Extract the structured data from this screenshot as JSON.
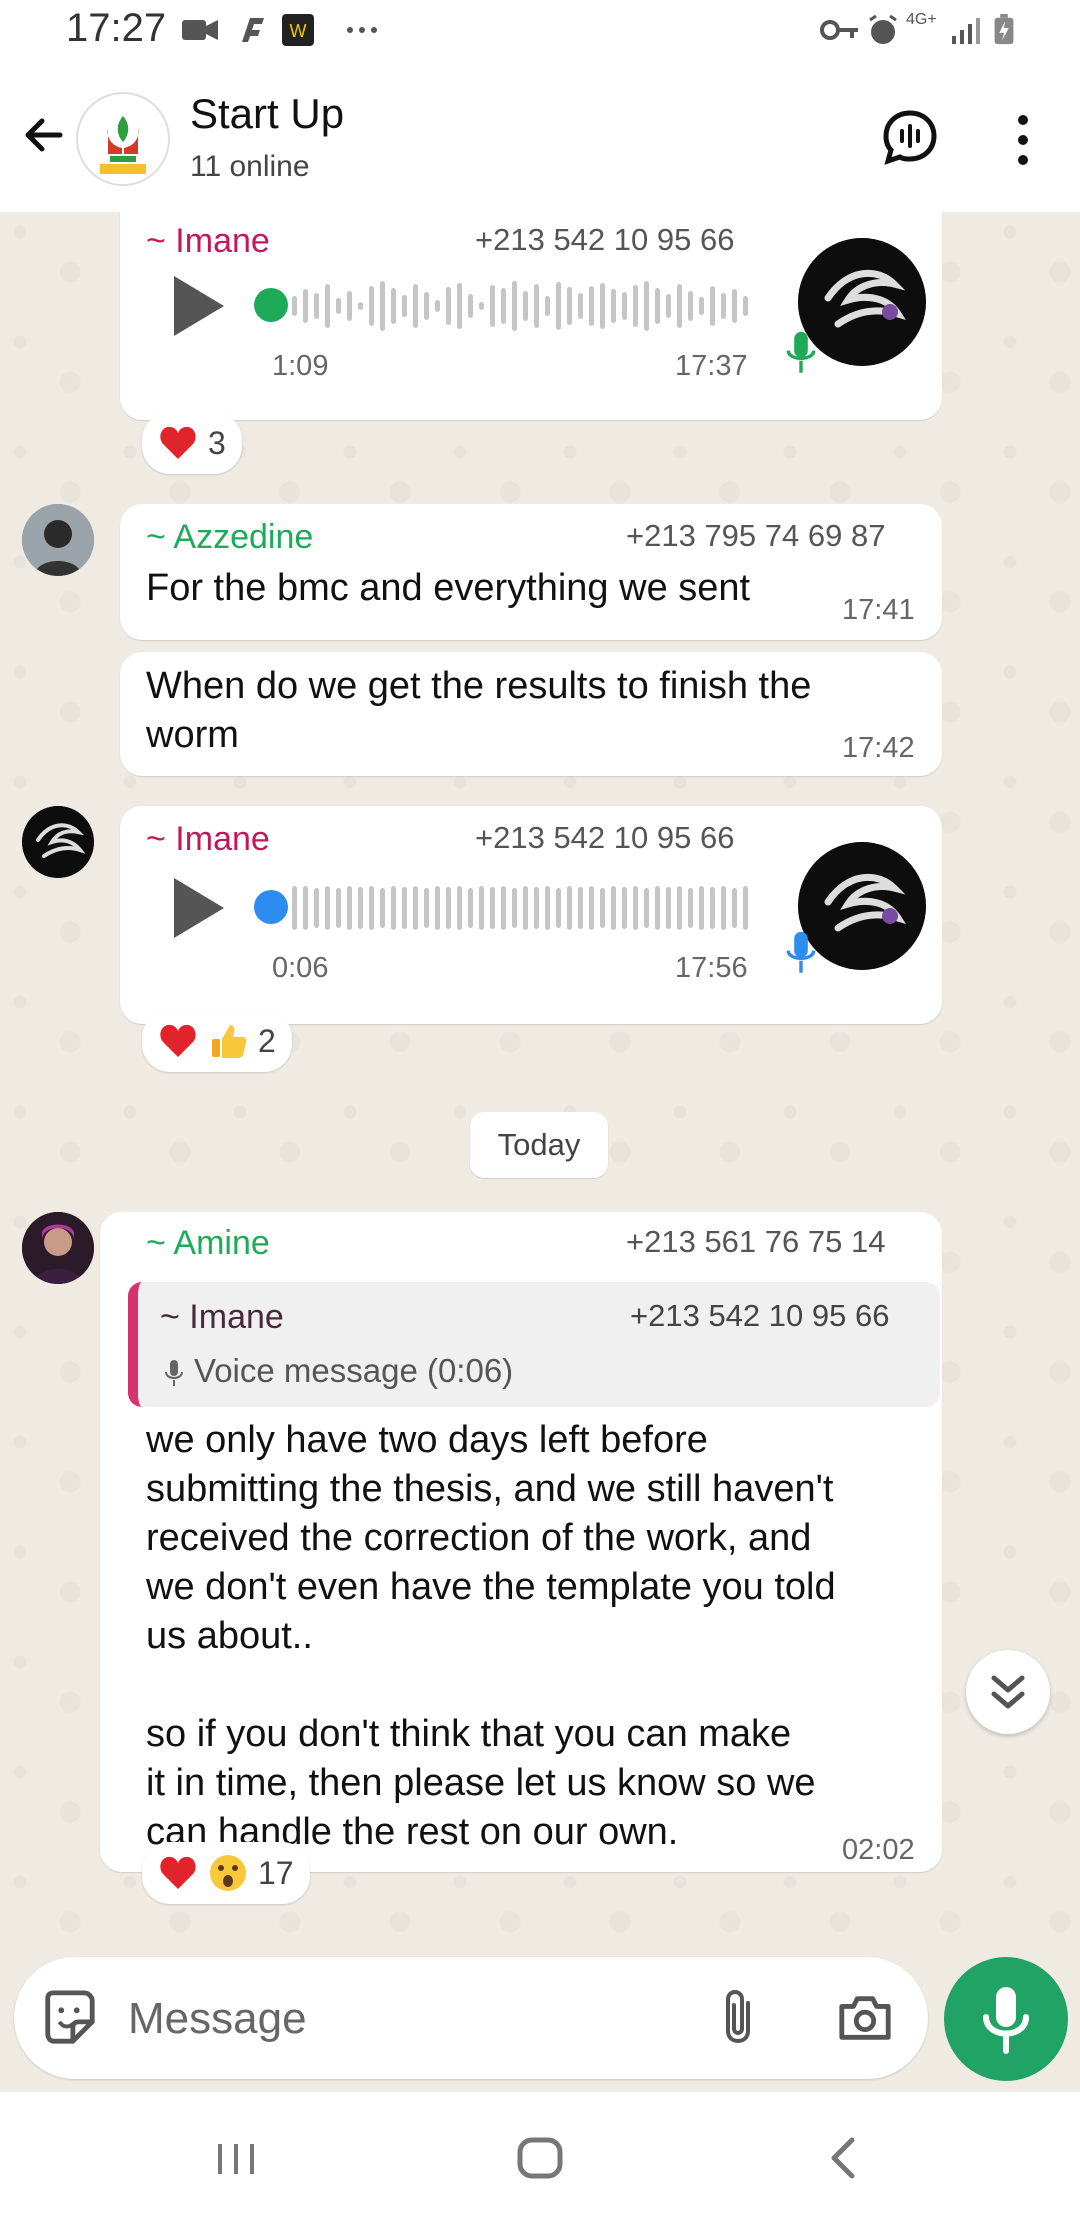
{
  "status": {
    "time": "17:27",
    "network": "4G+"
  },
  "header": {
    "title": "Start Up",
    "subtitle": "11 online"
  },
  "messages": [
    {
      "sender": "~ Imane",
      "phone": "+213 542 10 95 66",
      "duration": "1:09",
      "time": "17:37",
      "reaction_count": "3"
    },
    {
      "sender": "~ Azzedine",
      "phone": "+213 795 74 69 87",
      "text": "For the bmc and everything we sent",
      "time": "17:41"
    },
    {
      "text": "When do we get the results to finish the\nworm",
      "time": "17:42"
    },
    {
      "sender": "~ Imane",
      "phone": "+213 542 10 95 66",
      "duration": "0:06",
      "time": "17:56",
      "reaction_count": "2"
    },
    {
      "sender": "~ Amine",
      "phone": "+213 561 76 75 14",
      "quote": {
        "sender": "~ Imane",
        "phone": "+213 542 10 95 66",
        "text": "Voice message (0:06)"
      },
      "text": "we only have two days left before\nsubmitting the thesis, and we still haven't\nreceived the correction of the work, and\nwe don't even have the template you told\nus about..\n\nso if you don't think that you can make\nit in time, then please let us know so we\ncan handle the rest on our own.",
      "time": "02:02",
      "reaction_count": "17"
    }
  ],
  "day_divider": "Today",
  "composer": {
    "placeholder": "Message"
  },
  "colors": {
    "imane": "#c2185b",
    "green_name": "#1faa59",
    "accent": "#21a366",
    "quote_bar": "#d6336c"
  }
}
